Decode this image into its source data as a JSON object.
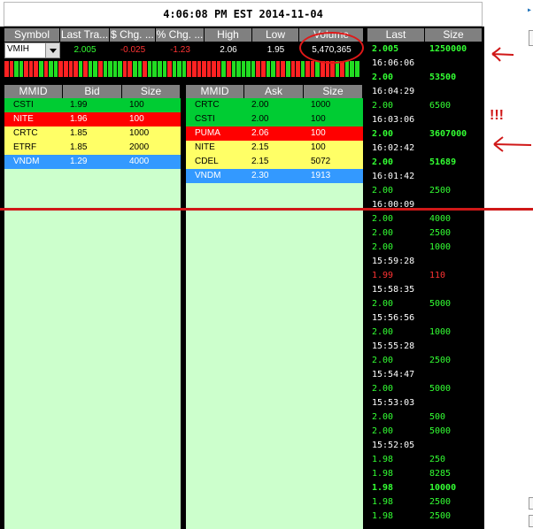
{
  "clock": "4:06:08 PM EST 2014-11-04",
  "quote": {
    "headers": [
      "Symbol",
      "Last Tra...",
      "$ Chg. ...",
      "% Chg. ...",
      "High",
      "Low",
      "Volume"
    ],
    "symbol": "VMIH",
    "last": "2.005",
    "chg": "-0.025",
    "pct": "-1.23",
    "high": "2.06",
    "low": "1.95",
    "volume": "5,470,365"
  },
  "ticks": [
    "r",
    "r",
    "g",
    "g",
    "r",
    "r",
    "r",
    "g",
    "r",
    "g",
    "g",
    "r",
    "r",
    "r",
    "r",
    "g",
    "r",
    "g",
    "g",
    "r",
    "g",
    "g",
    "g",
    "g",
    "r",
    "r",
    "g",
    "g",
    "r",
    "g",
    "g",
    "g",
    "g",
    "r",
    "g",
    "g",
    "g",
    "r",
    "r",
    "r",
    "r",
    "r",
    "r",
    "r",
    "g",
    "r",
    "g",
    "g",
    "g",
    "g",
    "g",
    "r",
    "r",
    "g",
    "g",
    "r",
    "r",
    "g",
    "r",
    "r",
    "g",
    "r",
    "r",
    "g",
    "r",
    "r",
    "r",
    "g",
    "r",
    "g",
    "g",
    "g"
  ],
  "bid": {
    "headers": [
      "MMID",
      "Bid",
      "Size"
    ],
    "rows": [
      {
        "mmid": "CSTI",
        "price": "1.99",
        "size": "100",
        "color": "green"
      },
      {
        "mmid": "NITE",
        "price": "1.96",
        "size": "100",
        "color": "red"
      },
      {
        "mmid": "CRTC",
        "price": "1.85",
        "size": "1000",
        "color": "yellow"
      },
      {
        "mmid": "ETRF",
        "price": "1.85",
        "size": "2000",
        "color": "yellow"
      },
      {
        "mmid": "VNDM",
        "price": "1.29",
        "size": "4000",
        "color": "blue"
      }
    ]
  },
  "ask": {
    "headers": [
      "MMID",
      "Ask",
      "Size"
    ],
    "rows": [
      {
        "mmid": "CRTC",
        "price": "2.00",
        "size": "1000",
        "color": "green"
      },
      {
        "mmid": "CSTI",
        "price": "2.00",
        "size": "100",
        "color": "green"
      },
      {
        "mmid": "PUMA",
        "price": "2.06",
        "size": "100",
        "color": "red"
      },
      {
        "mmid": "NITE",
        "price": "2.15",
        "size": "100",
        "color": "yellow"
      },
      {
        "mmid": "CDEL",
        "price": "2.15",
        "size": "5072",
        "color": "yellow"
      },
      {
        "mmid": "VNDM",
        "price": "2.30",
        "size": "1913",
        "color": "blue"
      }
    ]
  },
  "ts": {
    "headers": [
      "Last",
      "Size"
    ],
    "rows": [
      {
        "t": "trade",
        "price": "2.005",
        "size": "1250000",
        "bold": true,
        "c": "green"
      },
      {
        "t": "time",
        "text": "16:06:06"
      },
      {
        "t": "trade",
        "price": "2.00",
        "size": "53500",
        "bold": true,
        "c": "green"
      },
      {
        "t": "time",
        "text": "16:04:29"
      },
      {
        "t": "trade",
        "price": "2.00",
        "size": "6500",
        "bold": false,
        "c": "green"
      },
      {
        "t": "time",
        "text": "16:03:06"
      },
      {
        "t": "trade",
        "price": "2.00",
        "size": "3607000",
        "bold": true,
        "c": "green"
      },
      {
        "t": "time",
        "text": "16:02:42"
      },
      {
        "t": "trade",
        "price": "2.00",
        "size": "51689",
        "bold": true,
        "c": "green"
      },
      {
        "t": "time",
        "text": "16:01:42"
      },
      {
        "t": "trade",
        "price": "2.00",
        "size": "2500",
        "bold": false,
        "c": "green"
      },
      {
        "t": "time",
        "text": "16:00:09"
      },
      {
        "t": "trade",
        "price": "2.00",
        "size": "4000",
        "bold": false,
        "c": "green"
      },
      {
        "t": "trade",
        "price": "2.00",
        "size": "2500",
        "bold": false,
        "c": "green"
      },
      {
        "t": "trade",
        "price": "2.00",
        "size": "1000",
        "bold": false,
        "c": "green"
      },
      {
        "t": "time",
        "text": "15:59:28"
      },
      {
        "t": "trade",
        "price": "1.99",
        "size": "110",
        "bold": false,
        "c": "red"
      },
      {
        "t": "time",
        "text": "15:58:35"
      },
      {
        "t": "trade",
        "price": "2.00",
        "size": "5000",
        "bold": false,
        "c": "green"
      },
      {
        "t": "time",
        "text": "15:56:56"
      },
      {
        "t": "trade",
        "price": "2.00",
        "size": "1000",
        "bold": false,
        "c": "green"
      },
      {
        "t": "time",
        "text": "15:55:28"
      },
      {
        "t": "trade",
        "price": "2.00",
        "size": "2500",
        "bold": false,
        "c": "green"
      },
      {
        "t": "time",
        "text": "15:54:47"
      },
      {
        "t": "trade",
        "price": "2.00",
        "size": "5000",
        "bold": false,
        "c": "green"
      },
      {
        "t": "time",
        "text": "15:53:03"
      },
      {
        "t": "trade",
        "price": "2.00",
        "size": "500",
        "bold": false,
        "c": "green"
      },
      {
        "t": "trade",
        "price": "2.00",
        "size": "5000",
        "bold": false,
        "c": "green"
      },
      {
        "t": "time",
        "text": "15:52:05"
      },
      {
        "t": "trade",
        "price": "1.98",
        "size": "250",
        "bold": false,
        "c": "green"
      },
      {
        "t": "trade",
        "price": "1.98",
        "size": "8285",
        "bold": false,
        "c": "green"
      },
      {
        "t": "trade",
        "price": "1.98",
        "size": "10000",
        "bold": true,
        "c": "green"
      },
      {
        "t": "trade",
        "price": "1.98",
        "size": "2500",
        "bold": false,
        "c": "green"
      },
      {
        "t": "trade",
        "price": "1.98",
        "size": "2500",
        "bold": false,
        "c": "green"
      }
    ]
  },
  "annotations": {
    "exclaim": "!!!",
    "stroke_color": "#d01818"
  },
  "colors": {
    "green": "#00cc33",
    "red": "#ff0000",
    "yellow": "#ffff66",
    "blue": "#3399ff",
    "ts_green": "#33ff33",
    "ts_red": "#ff3333",
    "book_bg": "#ccffcc"
  }
}
